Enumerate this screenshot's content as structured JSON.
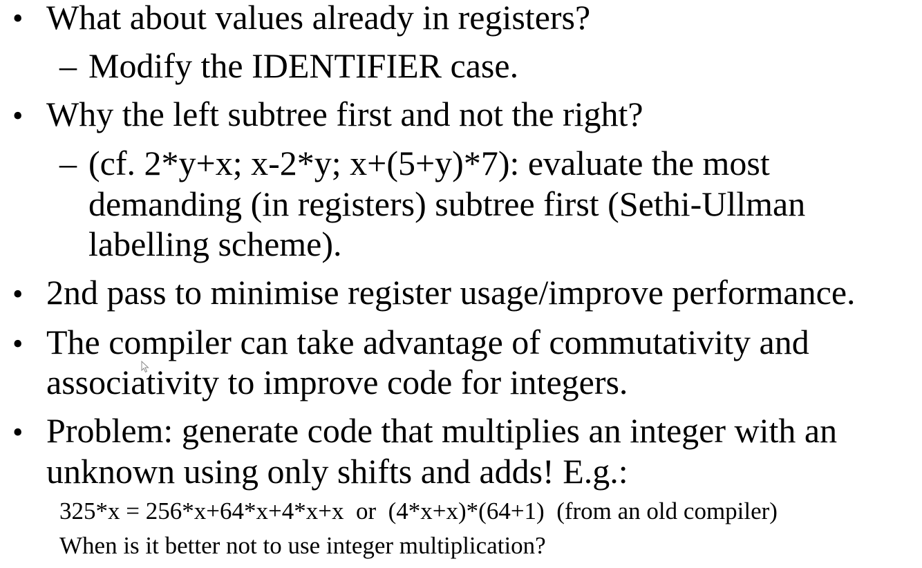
{
  "items": [
    {
      "text": "What about values already in registers?",
      "sub": [
        {
          "lines": [
            "Modify the IDENTIFIER case."
          ]
        }
      ]
    },
    {
      "text": "Why the left subtree first and not the right?",
      "sub": [
        {
          "lines": [
            "(cf. 2*y+x; x-2*y; x+(5+y)*7): evaluate the most",
            "demanding (in registers) subtree first (Sethi-Ullman",
            "labelling scheme)."
          ]
        }
      ]
    },
    {
      "lines": [
        "2nd pass to minimise register usage/improve performance."
      ]
    },
    {
      "lines": [
        "The compiler can take advantage of commutativity and",
        "associativity to improve code for integers."
      ]
    },
    {
      "lines": [
        "Problem: generate code that multiplies an integer with an",
        "unknown using only shifts and adds! E.g.:"
      ]
    }
  ],
  "bullet_glyph": "•",
  "dash_glyph": "–",
  "example": "325*x = 256*x+64*x+4*x+x  or  (4*x+x)*(64+1)  (from an old compiler)",
  "question": "When is it better not to use integer multiplication?"
}
